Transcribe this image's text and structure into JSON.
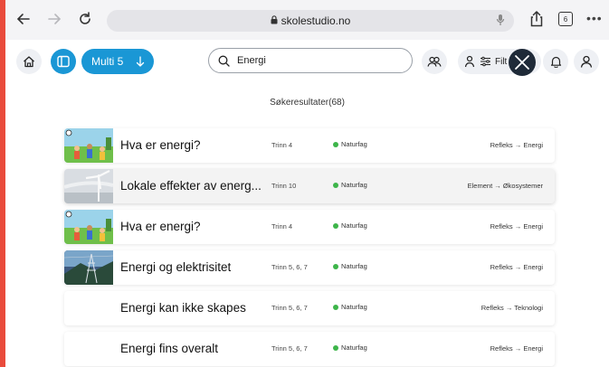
{
  "browser": {
    "url": "skolestudio.no",
    "tab_count": "6",
    "more": "•••"
  },
  "header": {
    "multi_label": "Multi 5",
    "search_value": "Energi",
    "filter_label": "Filt"
  },
  "results": {
    "title": "Søkeresultater(68)",
    "items": [
      {
        "title": "Hva er energi?",
        "grade": "Trinn 4",
        "subject": "Naturfag",
        "path": "Refleks → Energi",
        "thumb": "children-illustration"
      },
      {
        "title": "Lokale effekter av energ...",
        "grade": "Trinn 10",
        "subject": "Naturfag",
        "path": "Element → Økosystemer",
        "thumb": "wind-turbine-photo"
      },
      {
        "title": "Hva er energi?",
        "grade": "Trinn 4",
        "subject": "Naturfag",
        "path": "Refleks → Energi",
        "thumb": "children-illustration"
      },
      {
        "title": "Energi og elektrisitet",
        "grade": "Trinn 5, 6, 7",
        "subject": "Naturfag",
        "path": "Refleks → Energi",
        "thumb": "power-line-photo"
      },
      {
        "title": "Energi kan ikke skapes",
        "grade": "Trinn 5, 6, 7",
        "subject": "Naturfag",
        "path": "Refleks → Teknologi",
        "thumb": "none"
      },
      {
        "title": "Energi fins overalt",
        "grade": "Trinn 5, 6, 7",
        "subject": "Naturfag",
        "path": "Refleks → Energi",
        "thumb": "none"
      }
    ]
  },
  "colors": {
    "accent": "#1a97d5",
    "subject_dot": "#3db54a",
    "border_red": "#e94b3c"
  }
}
